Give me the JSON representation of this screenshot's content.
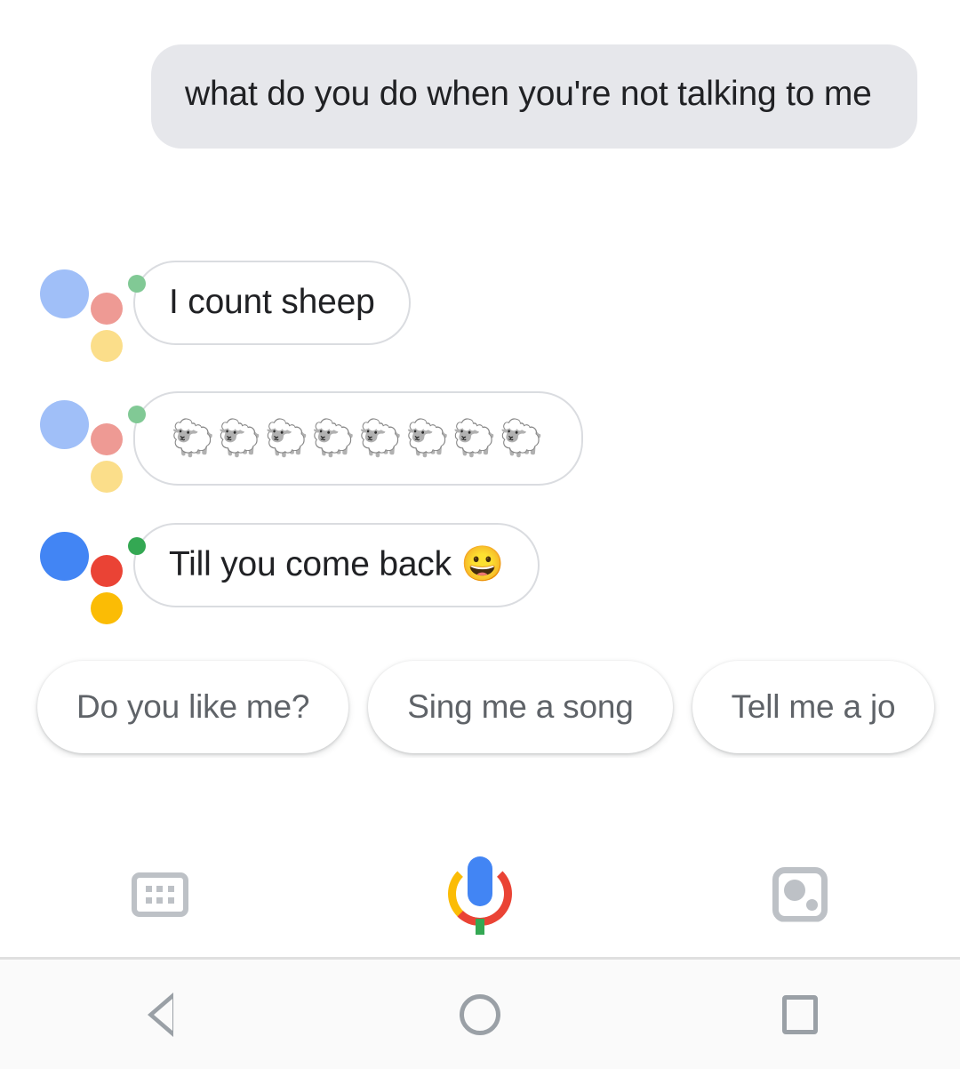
{
  "app": {
    "name": "Google Assistant",
    "screen": "conversation"
  },
  "conversation": {
    "user_query": {
      "speaker": "user",
      "text": "what do you do when you're not talking to me"
    },
    "assistant_replies": [
      {
        "speaker": "assistant",
        "text": "I count sheep",
        "avatar_state": "faded"
      },
      {
        "speaker": "assistant",
        "text": "🐑🐑🐑🐑🐑🐑🐑🐑",
        "sheep_count": "8",
        "avatar_state": "faded"
      },
      {
        "speaker": "assistant",
        "text": "Till you come back 😀",
        "avatar_state": "active"
      }
    ]
  },
  "suggestions": {
    "chips": [
      {
        "label": "Do you like me?"
      },
      {
        "label": "Sing me a song"
      },
      {
        "label": "Tell me a jo"
      }
    ]
  },
  "action_bar": {
    "keyboard": {
      "icon": "keyboard-icon",
      "label": "Keyboard"
    },
    "microphone": {
      "icon": "google-mic-icon",
      "label": "Microphone"
    },
    "lens": {
      "icon": "google-lens-icon",
      "label": "Google Lens"
    }
  },
  "navigation_bar": {
    "back": {
      "icon": "back-triangle-icon",
      "label": "Back"
    },
    "home": {
      "icon": "home-circle-icon",
      "label": "Home"
    },
    "recents": {
      "icon": "recents-square-icon",
      "label": "Recents"
    }
  },
  "colors": {
    "user_bubble_bg": "#E6E7EB",
    "bubble_border": "#DADCE0",
    "text_primary": "#202124",
    "chip_text": "#5F6368",
    "icon_grey": "#BDC1C6",
    "nav_icon_grey": "#9AA0A6",
    "google_blue": "#4285F4",
    "google_red": "#EA4335",
    "google_yellow": "#FBBC05",
    "google_green": "#34A853",
    "faded_blue": "#A0BFF8",
    "faded_red": "#EE9A94",
    "faded_yellow": "#FBDE8A",
    "faded_green": "#81C995",
    "nav_bar_bg": "#FAFAFA"
  }
}
